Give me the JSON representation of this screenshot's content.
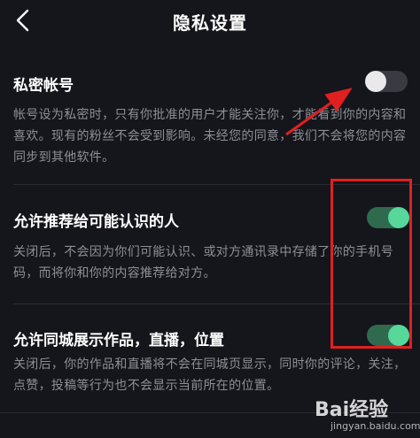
{
  "header": {
    "title": "隐私设置",
    "back_icon": "chevron-left-icon"
  },
  "settings": [
    {
      "title": "私密帐号",
      "description": "帐号设为私密时，只有你批准的用户才能关注你，才能看到你的内容和喜欢。现有的粉丝不会受到影响。未经您的同意，我们不会将您的内容同步到其他软件。",
      "enabled": false
    },
    {
      "title": "允许推荐给可能认识的人",
      "description": "关闭后，不会因为你们可能认识、或对方通讯录中存储了你的手机号码，而将你和你的内容推荐给对方。",
      "enabled": true
    },
    {
      "title": "允许同城展示作品，直播，位置",
      "description": "关闭后，你的作品和直播将不会在同城页显示，同时你的评论，关注，点赞，投稿等行为也不会显示当前所在的位置。",
      "enabled": true
    }
  ],
  "watermark": {
    "logo_text": "Bai经验",
    "url": "jingyan.baidu.com"
  },
  "colors": {
    "background": "#15151c",
    "toggle_on_track": "#2f6a4f",
    "toggle_on_knob": "#57d79a",
    "toggle_off_track": "#3a3a42",
    "toggle_off_knob": "#e9e9ec",
    "annotation": "#e02020"
  }
}
